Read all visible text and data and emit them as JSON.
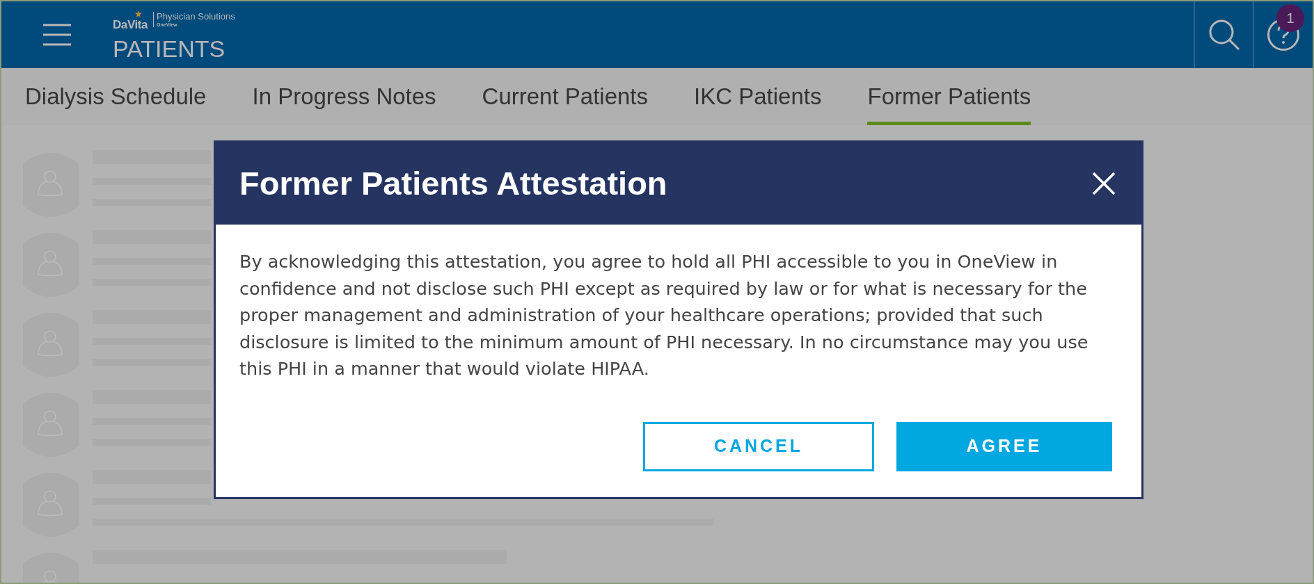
{
  "header": {
    "brand": "DaVita",
    "product": "Physician Solutions",
    "subproduct": "OneView",
    "title": "PATIENTS",
    "notification_count": "1"
  },
  "tabs": [
    {
      "label": "Dialysis Schedule",
      "selected": false
    },
    {
      "label": "In Progress Notes",
      "selected": false
    },
    {
      "label": "Current Patients",
      "selected": false
    },
    {
      "label": "IKC Patients",
      "selected": false
    },
    {
      "label": "Former Patients",
      "selected": true
    }
  ],
  "dialog": {
    "title": "Former Patients Attestation",
    "body": "By acknowledging this attestation, you agree to hold all PHI accessible to you in OneView in confidence and not disclose such PHI except as required by law or for what is necessary for the proper management and administration of your healthcare operations; provided that such disclosure is limited to the minimum amount of PHI necessary. In no circumstance may you use this PHI in a manner that would violate HIPAA.",
    "buttons": [
      {
        "label": "CANCEL",
        "kind": "secondary"
      },
      {
        "label": "AGREE",
        "kind": "primary"
      }
    ]
  }
}
